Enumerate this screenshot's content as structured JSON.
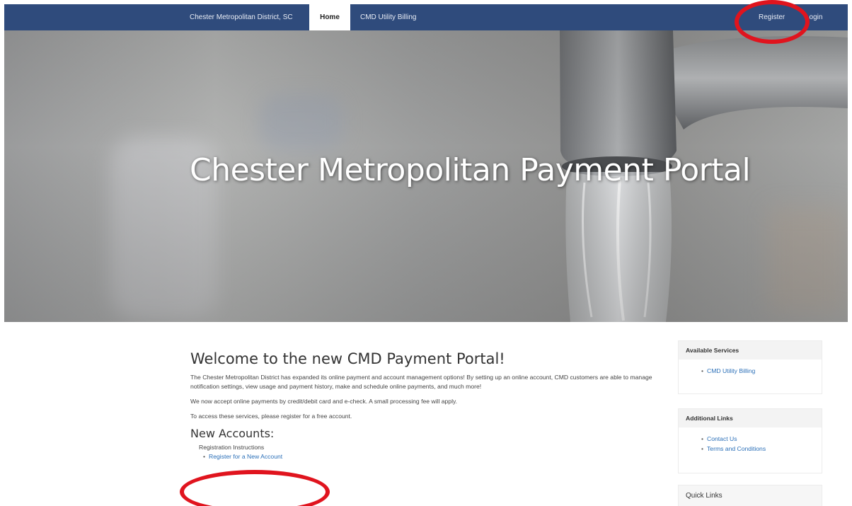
{
  "nav": {
    "brand": "Chester Metropolitan District, SC",
    "home": "Home",
    "billing": "CMD Utility Billing",
    "register": "Register",
    "login": "Login"
  },
  "hero": {
    "title": "Chester Metropolitan Payment Portal"
  },
  "main": {
    "welcome_title": "Welcome to the new CMD Payment Portal!",
    "intro": "The Chester Metropolitan District has expanded its online payment and account management options! By setting up an online account, CMD customers are able to manage notification settings, view usage and payment history, make and schedule online payments, and much more!",
    "payments": "We now accept online payments by credit/debit card and e-check. A small processing fee will apply.",
    "access": "To access these services, please register for a free account.",
    "new_accounts_title": "New Accounts:",
    "registration_instructions": "Registration Instructions",
    "register_link": "Register for a New Account"
  },
  "sidebar": {
    "services": {
      "title": "Available Services",
      "items": [
        "CMD Utility Billing"
      ]
    },
    "additional": {
      "title": "Additional Links",
      "items": [
        "Contact Us",
        "Terms and Conditions"
      ]
    },
    "quick": {
      "title": "Quick Links"
    }
  },
  "colors": {
    "navbar": "#2f4b7c",
    "link": "#2a6fb8",
    "highlight": "#e0141e"
  }
}
